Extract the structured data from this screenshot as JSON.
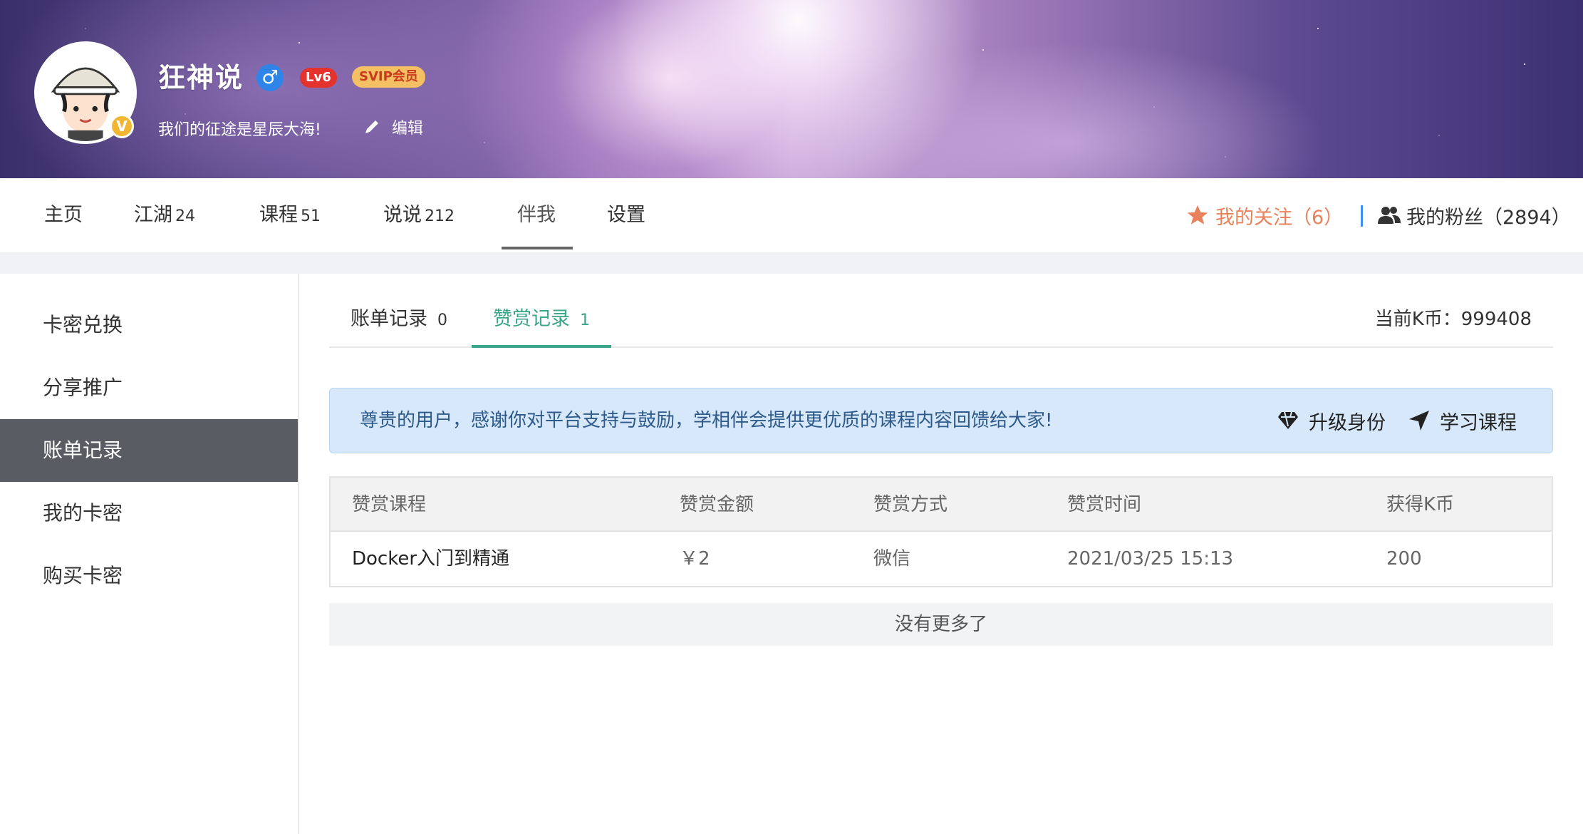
{
  "profile": {
    "username": "狂神说",
    "gender_symbol": "♂",
    "level": "Lv6",
    "svip": "SVIP会员",
    "avatar_badge": "V",
    "motto": "我们的征途是星辰大海!",
    "edit_label": "编辑"
  },
  "nav": {
    "items": [
      {
        "label": "主页",
        "count": ""
      },
      {
        "label": "江湖",
        "count": "24"
      },
      {
        "label": "课程",
        "count": "51"
      },
      {
        "label": "说说",
        "count": "212"
      },
      {
        "label": "伴我",
        "count": ""
      },
      {
        "label": "设置",
        "count": ""
      }
    ],
    "active_index": 4,
    "follow_label": "我的关注（6）",
    "fans_label": "我的粉丝（2894）"
  },
  "sidebar": {
    "items": [
      {
        "label": "卡密兑换"
      },
      {
        "label": "分享推广"
      },
      {
        "label": "账单记录"
      },
      {
        "label": "我的卡密"
      },
      {
        "label": "购买卡密"
      }
    ],
    "active_index": 2
  },
  "tabs": {
    "items": [
      {
        "label": "账单记录",
        "count": "0"
      },
      {
        "label": "赞赏记录",
        "count": "1"
      }
    ],
    "active_index": 1,
    "kcoin_label": "当前K币：999408"
  },
  "notice": {
    "text": "尊贵的用户，感谢你对平台支持与鼓励，学相伴会提供更优质的课程内容回馈给大家!",
    "upgrade_label": "升级身份",
    "study_label": "学习课程"
  },
  "table": {
    "headers": [
      "赞赏课程",
      "赞赏金额",
      "赞赏方式",
      "赞赏时间",
      "获得K币"
    ],
    "rows": [
      [
        "Docker入门到精通",
        "￥2",
        "微信",
        "2021/03/25 15:13",
        "200"
      ]
    ]
  },
  "no_more": "没有更多了",
  "colors": {
    "accent_green": "#3aa58a",
    "follow_orange": "#e9825b",
    "sidebar_active": "#595c62",
    "notice_bg": "#d7e8fb"
  }
}
